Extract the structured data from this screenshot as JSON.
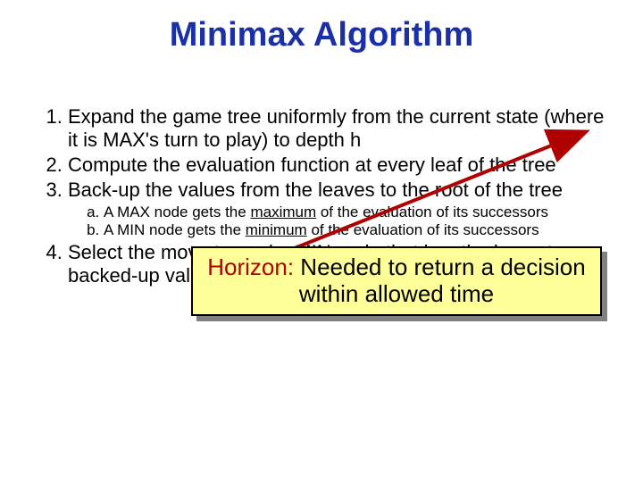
{
  "title": "Minimax Algorithm",
  "items": {
    "i1": "Expand the game tree uniformly from the current state (where it is MAX's turn to play) to depth h",
    "i2": "Compute the evaluation function at every leaf of the tree",
    "i3": "Back-up the values from the leaves to the root of the tree",
    "i3a_pre": "A MAX node gets the ",
    "i3a_u": "maximum",
    "i3a_post": " of the evaluation of its successors",
    "i3b_pre": "A MIN node gets the ",
    "i3b_u": "minimum",
    "i3b_post": " of the evaluation of its successors",
    "i4": "Select the move toward a MIN node that has the largest backed-up value"
  },
  "callout": {
    "highlight": "Horizon:",
    "rest": " Needed to return a decision within allowed time"
  }
}
